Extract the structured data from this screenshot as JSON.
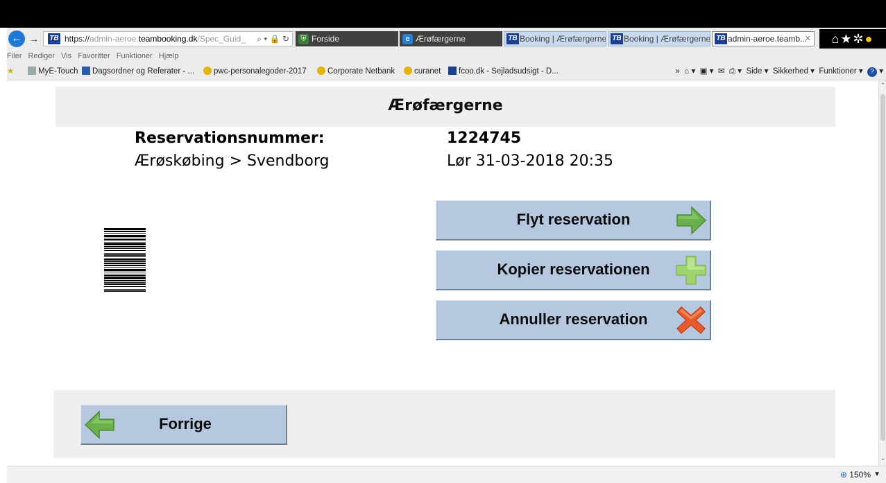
{
  "browser": {
    "address": {
      "scheme": "https://",
      "host_dim": "admin-aeroe.",
      "host_strong": "teambooking.dk",
      "path": "/Spec_Guid_"
    },
    "tabs": [
      {
        "label": "Forside",
        "style": "dark"
      },
      {
        "label": "Ærøfærgerne",
        "style": "dark"
      },
      {
        "label": "Booking | Ærøfærgerne",
        "style": "light"
      },
      {
        "label": "Booking | Ærøfærgerne",
        "style": "light"
      },
      {
        "label": "admin-aeroe.teamb...",
        "style": "active"
      }
    ],
    "menu": [
      "Filer",
      "Rediger",
      "Vis",
      "Favoritter",
      "Funktioner",
      "Hjælp"
    ],
    "favorites": [
      "MyE-Touch",
      "Dagsordner og Referater - ...",
      "pwc-personalegoder-2017",
      "Corporate Netbank",
      "curanet",
      "fcoo.dk - Sejladsudsigt - D..."
    ],
    "commands": {
      "side": "Side",
      "security": "Sikkerhed",
      "tools": "Funktioner"
    },
    "zoom": "150%"
  },
  "page": {
    "title": "Ærøfærgerne",
    "reservation_label": "Reservationsnummer:",
    "reservation_number": "1224745",
    "route": "Ærøskøbing > Svendborg",
    "departure": "Lør 31-03-2018 20:35",
    "actions": {
      "move": "Flyt reservation",
      "copy": "Kopier reservationen",
      "cancel": "Annuller reservation"
    },
    "back_label": "Forrige"
  },
  "colors": {
    "button_bg": "#b5c8e0",
    "band_bg": "#efefef",
    "arrow_green": "#6ab04c",
    "plus_green": "#9fd36e",
    "cancel_orange": "#e8592b"
  },
  "icons": {
    "move": "arrow-right-icon",
    "copy": "plus-icon",
    "cancel": "x-icon",
    "back": "arrow-left-icon"
  }
}
